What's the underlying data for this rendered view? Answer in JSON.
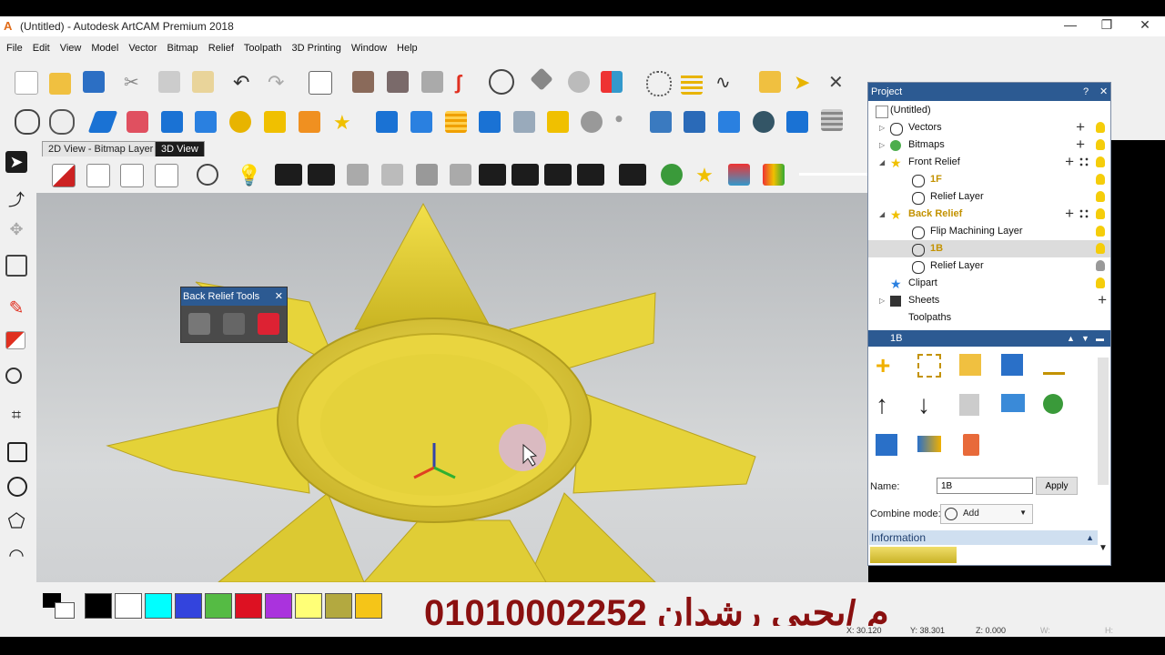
{
  "window": {
    "title": "(Untitled) - Autodesk ArtCAM Premium 2018",
    "logo": "A",
    "minimize": "—",
    "maximize": "❐",
    "close": "✕"
  },
  "menu": [
    "File",
    "Edit",
    "View",
    "Model",
    "Vector",
    "Bitmap",
    "Relief",
    "Toolpath",
    "3D Printing",
    "Window",
    "Help"
  ],
  "tabs": {
    "bitmap": "2D View - Bitmap Layer",
    "view3d": "3D View"
  },
  "project": {
    "title": "Project",
    "help": "?",
    "close": "✕",
    "items": [
      {
        "label": "(Untitled)"
      },
      {
        "label": "Vectors"
      },
      {
        "label": "Bitmaps"
      },
      {
        "label": "Front Relief"
      },
      {
        "label": "1F"
      },
      {
        "label": "Relief Layer"
      },
      {
        "label": "Back Relief"
      },
      {
        "label": "Flip Machining Layer"
      },
      {
        "label": "1B"
      },
      {
        "label": "Relief Layer"
      },
      {
        "label": "Clipart"
      },
      {
        "label": "Sheets"
      },
      {
        "label": "Toolpaths"
      }
    ]
  },
  "layer_panel": {
    "title": "1B",
    "name_label": "Name:",
    "name_value": "1B",
    "apply_label": "Apply",
    "combine_label": "Combine mode:",
    "combine_value": "Add",
    "information_label": "Information"
  },
  "back_relief_tools": {
    "title": "Back Relief Tools",
    "close": "✕"
  },
  "colors": [
    "#000000",
    "#ffffff",
    "#00ffff",
    "#3344dd",
    "#55bb44",
    "#dd1122",
    "#aa33dd",
    "#ffff77",
    "#b3a940",
    "#f5c518"
  ],
  "watermark": "م /يحيى رشدان 01010002252",
  "status": {
    "x": "X: 30.120",
    "y": "Y: 38.301",
    "z": "Z: 0.000",
    "w": "W:",
    "h": "H:"
  }
}
